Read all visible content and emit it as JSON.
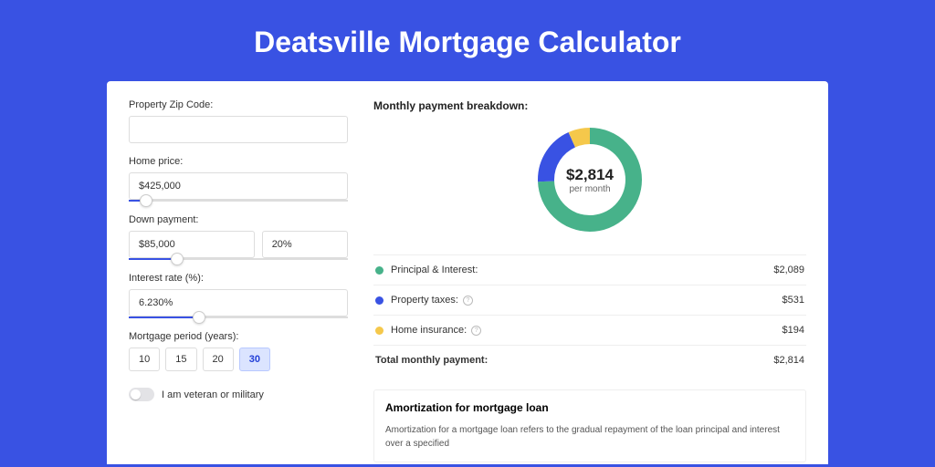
{
  "title": "Deatsville Mortgage Calculator",
  "form": {
    "zip": {
      "label": "Property Zip Code:",
      "value": ""
    },
    "price": {
      "label": "Home price:",
      "value": "$425,000",
      "slider_pct": 8
    },
    "down": {
      "label": "Down payment:",
      "amount": "$85,000",
      "pct": "20%",
      "slider_pct": 22
    },
    "rate": {
      "label": "Interest rate (%):",
      "value": "6.230%",
      "slider_pct": 32
    },
    "period": {
      "label": "Mortgage period (years):",
      "options": [
        "10",
        "15",
        "20",
        "30"
      ],
      "selected": "30"
    },
    "veteran": {
      "label": "I am veteran or military"
    }
  },
  "breakdown": {
    "title": "Monthly payment breakdown:",
    "center_amount": "$2,814",
    "center_sub": "per month",
    "items": [
      {
        "label": "Principal & Interest:",
        "value": "$2,089",
        "color": "#47b28a",
        "info": false
      },
      {
        "label": "Property taxes:",
        "value": "$531",
        "color": "#3952e3",
        "info": true
      },
      {
        "label": "Home insurance:",
        "value": "$194",
        "color": "#f5c84b",
        "info": true
      }
    ],
    "total": {
      "label": "Total monthly payment:",
      "value": "$2,814"
    }
  },
  "amort": {
    "title": "Amortization for mortgage loan",
    "text": "Amortization for a mortgage loan refers to the gradual repayment of the loan principal and interest over a specified"
  },
  "chart_data": {
    "type": "pie",
    "title": "Monthly payment breakdown",
    "series": [
      {
        "name": "Principal & Interest",
        "value": 2089,
        "color": "#47b28a"
      },
      {
        "name": "Property taxes",
        "value": 531,
        "color": "#3952e3"
      },
      {
        "name": "Home insurance",
        "value": 194,
        "color": "#f5c84b"
      }
    ],
    "total": 2814
  }
}
